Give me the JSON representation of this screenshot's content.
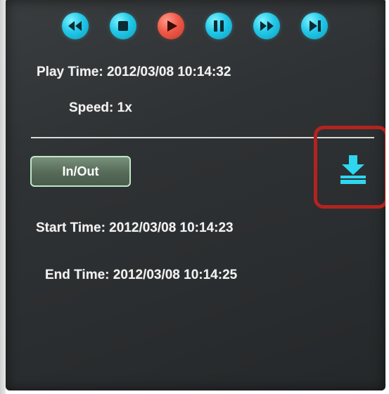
{
  "playback_controls": [
    {
      "name": "rewind-button",
      "icon": "rewind-icon"
    },
    {
      "name": "stop-button",
      "icon": "stop-icon"
    },
    {
      "name": "play-button",
      "icon": "play-icon"
    },
    {
      "name": "pause-button",
      "icon": "pause-icon"
    },
    {
      "name": "fast-forward-button",
      "icon": "fast-forward-icon"
    },
    {
      "name": "next-frame-button",
      "icon": "skip-next-icon"
    }
  ],
  "status": {
    "play_time": "Play Time: 2012/03/08 10:14:32",
    "speed": "Speed: 1x"
  },
  "clip": {
    "in_out_label": "In/Out",
    "start_time": "Start Time: 2012/03/08 10:14:23",
    "end_time": "End Time: 2012/03/08 10:14:25"
  },
  "colors": {
    "control_cyan": "#22c8e8",
    "play_red": "#ef5a48",
    "highlight_red": "#b3231f",
    "download_cyan": "#2fd6f0"
  }
}
